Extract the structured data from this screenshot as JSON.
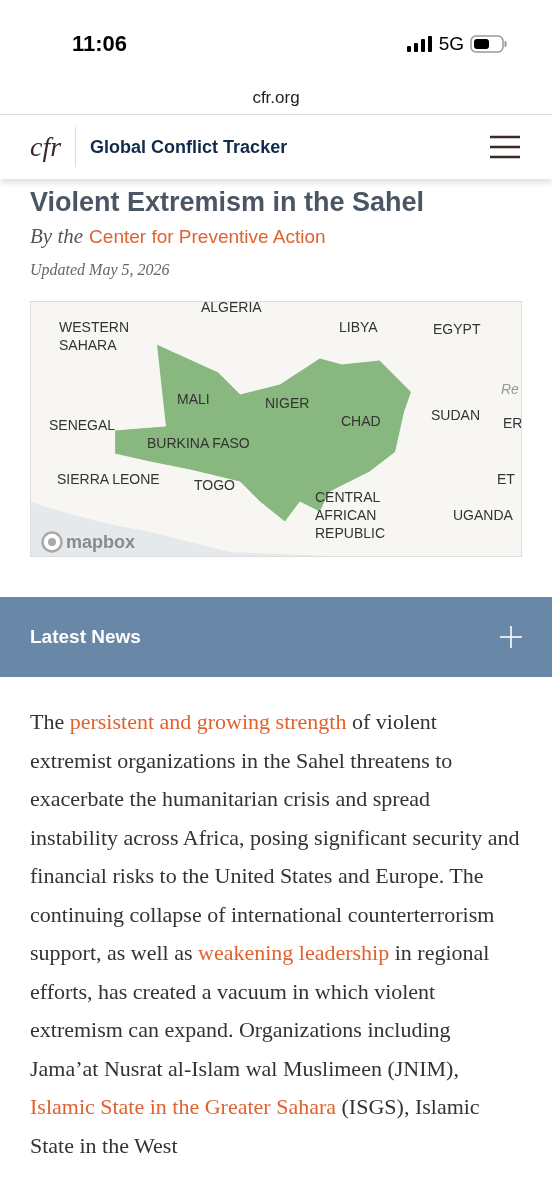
{
  "status_bar": {
    "time": "11:06",
    "network": "5G"
  },
  "browser": {
    "url": "cfr.org"
  },
  "header": {
    "logo": "cfr",
    "title": "Global Conflict Tracker"
  },
  "article": {
    "title": "Violent Extremism in the Sahel",
    "byline_prefix": "By the",
    "byline_link": "Center for Preventive Action",
    "updated": "Updated May 5, 2026"
  },
  "map": {
    "labels": [
      "ALGERIA",
      "WESTERN SAHARA",
      "LIBYA",
      "EGYPT",
      "Re",
      "MALI",
      "NIGER",
      "SENEGAL",
      "CHAD",
      "SUDAN",
      "ER",
      "BURKINA FASO",
      "SIERRA LEONE",
      "TOGO",
      "CENTRAL AFRICAN REPUBLIC",
      "ET",
      "UGANDA"
    ],
    "attribution": "mapbox"
  },
  "latest_news": {
    "label": "Latest News",
    "expanded": false
  },
  "body": [
    {
      "text": "The ",
      "link": false
    },
    {
      "text": "persistent and growing strength",
      "link": true
    },
    {
      "text": " of violent extremist organizations in the Sahel threatens to exacerbate the humanitarian crisis and spread instability across Africa, posing significant security and financial risks to the United States and Europe. The continuing collapse of international counterterrorism support, as well as ",
      "link": false
    },
    {
      "text": "weakening leadership",
      "link": true
    },
    {
      "text": " in regional efforts, has created a vacuum in which violent extremism can expand. Organizations including Jama’at Nusrat al-Islam wal Muslimeen (JNIM), ",
      "link": false
    },
    {
      "text": "Islamic State in the Greater Sahara",
      "link": true
    },
    {
      "text": " (ISGS), Islamic State in the West",
      "link": false
    }
  ]
}
